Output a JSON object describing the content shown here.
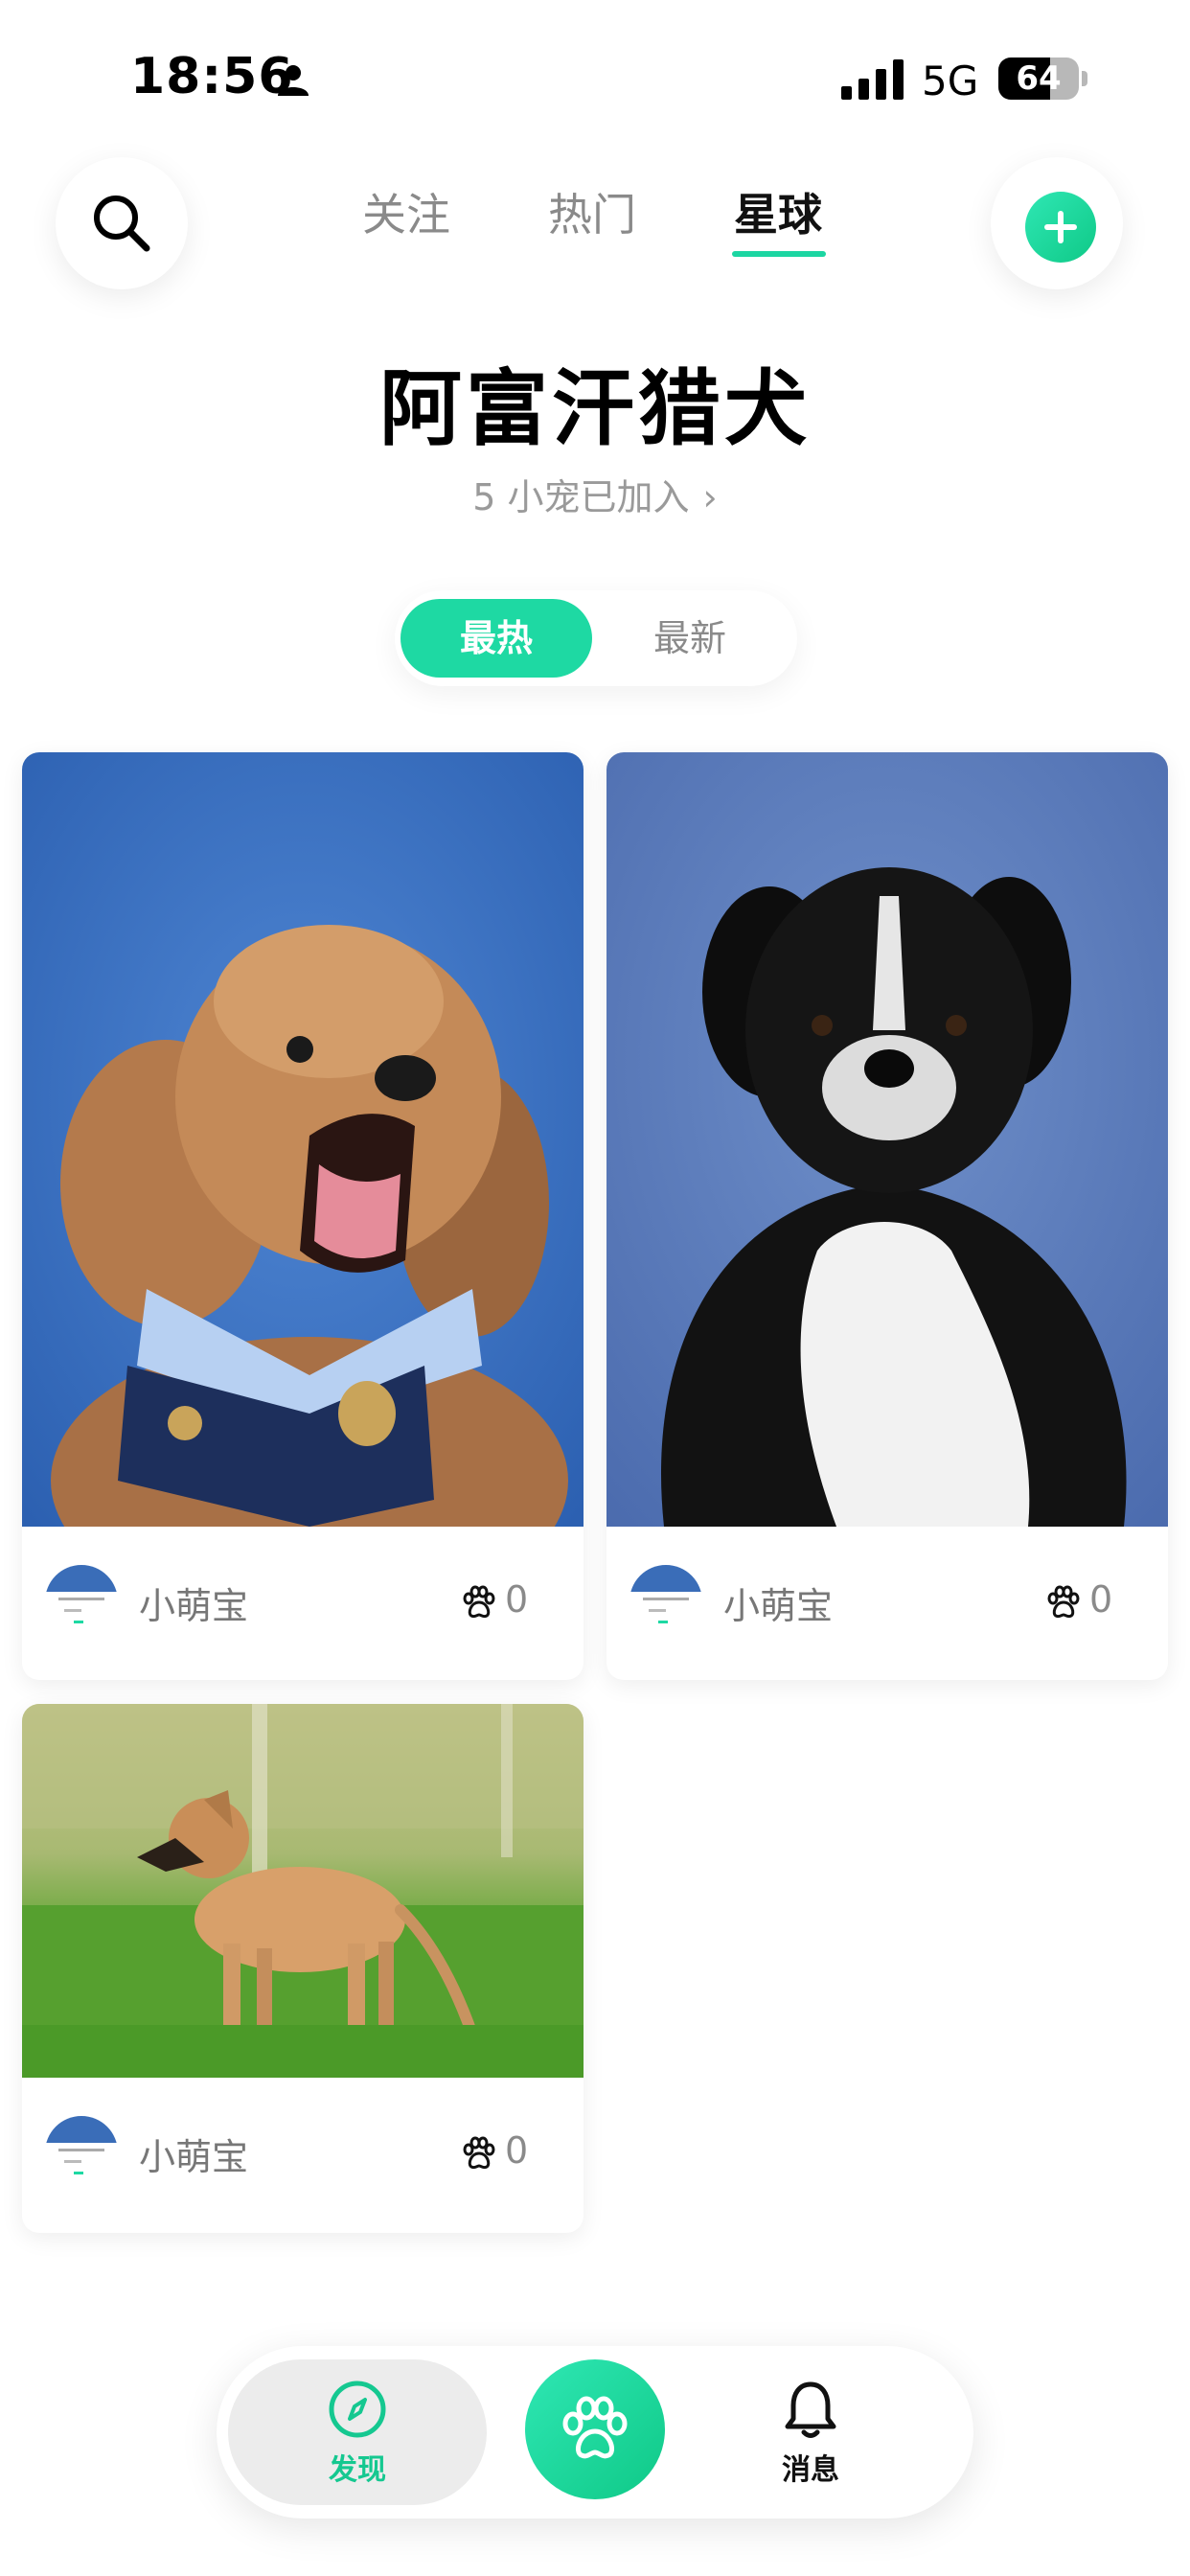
{
  "status_bar": {
    "time": "18:56",
    "network": "5G",
    "battery": "64",
    "battery_level": 0.64
  },
  "nav": {
    "tabs": [
      {
        "label": "关注",
        "active": false
      },
      {
        "label": "热门",
        "active": false
      },
      {
        "label": "星球",
        "active": true
      }
    ]
  },
  "header": {
    "title": "阿富汗猎犬",
    "members_text": "5 小宠已加入",
    "members_chevron": "›"
  },
  "sort": {
    "hot_label": "最热",
    "new_label": "最新",
    "selected": "hot"
  },
  "posts": [
    {
      "author": "小萌宝",
      "likes": "0",
      "image": "poodle-yawning-photo"
    },
    {
      "author": "小萌宝",
      "likes": "0",
      "image": "black-dog-portrait-photo"
    },
    {
      "author": "小萌宝",
      "likes": "0",
      "image": "puppy-on-grass-photo"
    }
  ],
  "tabbar": {
    "discover_label": "发现",
    "messages_label": "消息"
  },
  "colors": {
    "accent": "#1ed9a3",
    "accent_text": "#15c890"
  },
  "icons": [
    "search-icon",
    "plus-icon",
    "paw-icon",
    "compass-icon",
    "bell-icon",
    "person-icon",
    "signal-icon"
  ]
}
